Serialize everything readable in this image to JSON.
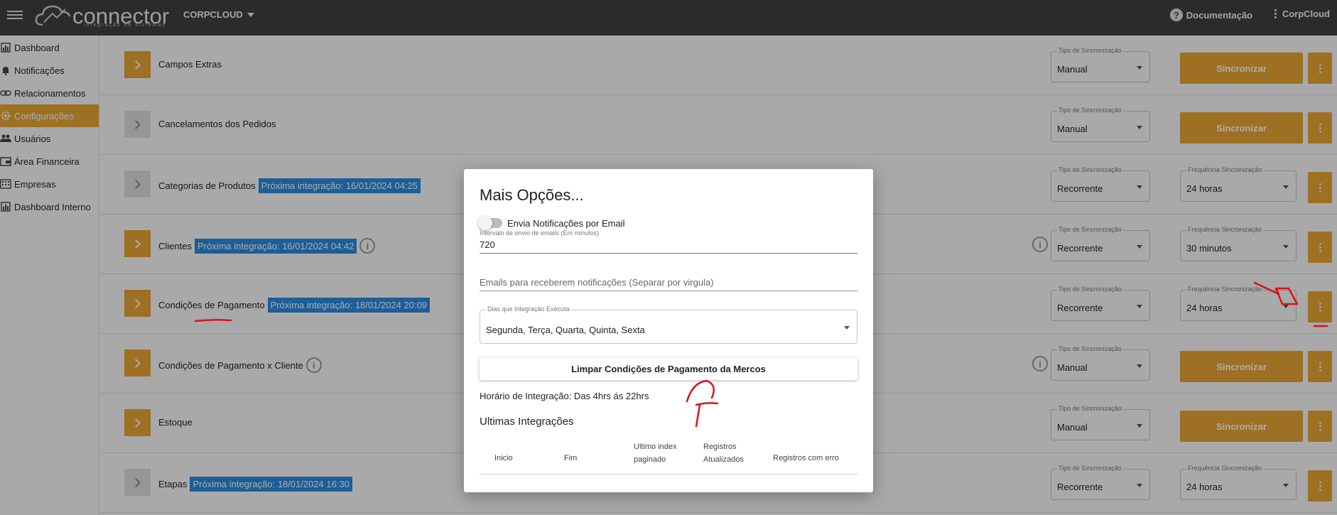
{
  "topbar": {
    "logo_text": "connector",
    "logo_sub": "integração de sistemas",
    "org": "CORPCLOUD",
    "docs": "Documentação",
    "user": "CorpCloud"
  },
  "sidebar": {
    "items": [
      {
        "label": "Dashboard",
        "icon": "bar-chart-icon"
      },
      {
        "label": "Notificações",
        "icon": "bell-icon"
      },
      {
        "label": "Relacionamentos",
        "icon": "link-icon"
      },
      {
        "label": "Configurações",
        "icon": "gear-icon",
        "active": true
      },
      {
        "label": "Usuários",
        "icon": "users-icon"
      },
      {
        "label": "Área Financeira",
        "icon": "wallet-icon"
      },
      {
        "label": "Empresas",
        "icon": "building-icon"
      },
      {
        "label": "Dashboard Interno",
        "icon": "bar-chart-icon"
      }
    ]
  },
  "rows": [
    {
      "label": "Campos Extras",
      "badge": "",
      "tipo_legend": "Tipo de Sincronização",
      "tipo": "Manual",
      "freq_legend": "",
      "freq": "",
      "action": "Sincronizar"
    },
    {
      "label": "Cancelamentos dos Pedidos",
      "badge": "",
      "tipo_legend": "Tipo de Sincronização",
      "tipo": "Manual",
      "freq_legend": "",
      "freq": "",
      "action": "Sincronizar"
    },
    {
      "label": "Categorias de Produtos",
      "badge": "Próxima integração: 16/01/2024 04:25",
      "tipo_legend": "Tipo de Sincronização",
      "tipo": "Recorrente",
      "freq_legend": "Frequência Sincronização",
      "freq": "24 horas",
      "action": ""
    },
    {
      "label": "Clientes",
      "badge": "Próxima integração: 16/01/2024 04:42",
      "tipo_legend": "Tipo de Sincronização",
      "tipo": "Recorrente",
      "freq_legend": "Frequência Sincronização",
      "freq": "30 minutos",
      "action": ""
    },
    {
      "label": "Condições de Pagamento",
      "badge": "Próxima integração: 18/01/2024 20:09",
      "tipo_legend": "Tipo de Sincronização",
      "tipo": "Recorrente",
      "freq_legend": "Frequência Sincronização",
      "freq": "24 horas",
      "action": ""
    },
    {
      "label": "Condições de Pagamento x Cliente",
      "badge": "",
      "tipo_legend": "Tipo de Sincronização",
      "tipo": "Manual",
      "freq_legend": "",
      "freq": "",
      "action": "Sincronizar"
    },
    {
      "label": "Estoque",
      "badge": "",
      "tipo_legend": "Tipo de Sincronização",
      "tipo": "Manual",
      "freq_legend": "",
      "freq": "",
      "action": "Sincronizar"
    },
    {
      "label": "Etapas",
      "badge": "Próxima integração: 18/01/2024 16:30",
      "tipo_legend": "Tipo de Sincronização",
      "tipo": "Recorrente",
      "freq_legend": "Frequência Sincronização",
      "freq": "24 horas",
      "action": ""
    }
  ],
  "modal": {
    "title": "Mais Opções...",
    "toggle_label": "Envia Notificações por Email",
    "interval_label": "Intervalo de envio de emails (Em minutos)",
    "interval_value": "720",
    "emails_placeholder": "Emails para receberem notificações (Separar por virgula)",
    "days_legend": "Dias que Integração Executa",
    "days_value": "Segunda, Terça, Quarta, Quinta, Sexta",
    "clear_button": "Limpar Condições de Pagamento da Mercos",
    "horario": "Horário de Integração: Das 4hrs ás 22hrs",
    "ultimas_title": "Ultimas Integrações",
    "table_headers": {
      "inicio": "Inicio",
      "fim": "Fim",
      "ultimo_1": "Ultimo index",
      "ultimo_2": "paginado",
      "registros_1": "Registros",
      "registros_2": "Atualizados",
      "erros": "Registros com erro"
    }
  },
  "colors": {
    "accent": "#e7a636",
    "badge": "#2a8be0",
    "topbar": "#404040",
    "annotation": "#e0101a"
  }
}
